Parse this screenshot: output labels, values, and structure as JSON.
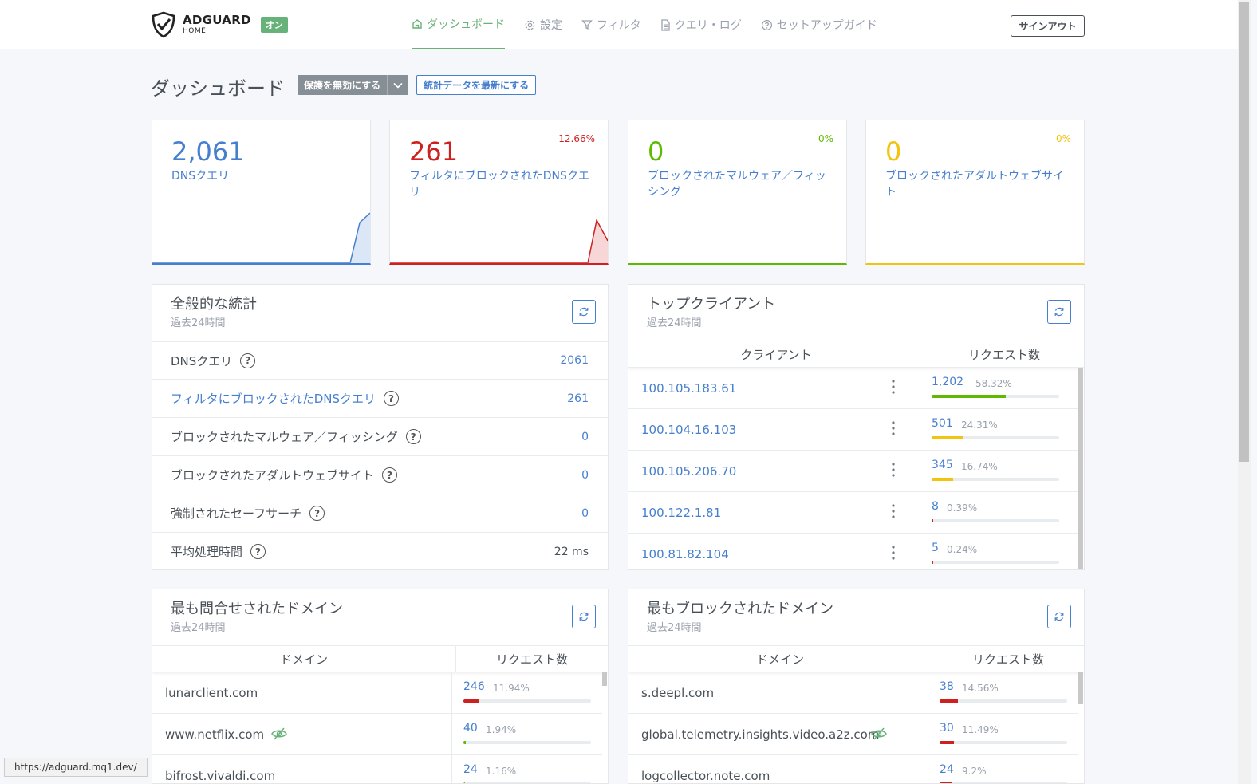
{
  "app": {
    "logo_name": "ADGUARD",
    "logo_sub": "HOME",
    "status_badge": "オン",
    "signout_label": "サインアウト"
  },
  "nav": {
    "items": [
      {
        "label": "ダッシュボード",
        "icon": "home-icon",
        "active": true
      },
      {
        "label": "設定",
        "icon": "gear-icon",
        "active": false
      },
      {
        "label": "フィルタ",
        "icon": "filter-icon",
        "active": false
      },
      {
        "label": "クエリ・ログ",
        "icon": "document-icon",
        "active": false
      },
      {
        "label": "セットアップガイド",
        "icon": "help-circle-icon",
        "active": false
      }
    ]
  },
  "header": {
    "title": "ダッシュボード",
    "disable_button": "保護を無効にする",
    "refresh_button": "統計データを最新にする"
  },
  "stats": [
    {
      "value": "2,061",
      "label": "DNSクエリ",
      "percent": "",
      "color": "#467fcf"
    },
    {
      "value": "261",
      "label": "フィルタにブロックされたDNSクエリ",
      "percent": "12.66%",
      "color": "#cd201f"
    },
    {
      "value": "0",
      "label": "ブロックされたマルウェア／フィッシング",
      "percent": "0%",
      "color": "#5eba00"
    },
    {
      "value": "0",
      "label": "ブロックされたアダルトウェブサイト",
      "percent": "0%",
      "color": "#f1c40f"
    }
  ],
  "general": {
    "title": "全般的な統計",
    "subtitle": "過去24時間",
    "rows": [
      {
        "label": "DNSクエリ",
        "value": "2061",
        "link": false
      },
      {
        "label": "フィルタにブロックされたDNSクエリ",
        "value": "261",
        "link": true
      },
      {
        "label": "ブロックされたマルウェア／フィッシング",
        "value": "0",
        "link": false
      },
      {
        "label": "ブロックされたアダルトウェブサイト",
        "value": "0",
        "link": false
      },
      {
        "label": "強制されたセーフサーチ",
        "value": "0",
        "link": false
      },
      {
        "label": "平均処理時間",
        "value": "22 ms",
        "link": false
      }
    ]
  },
  "top_clients": {
    "title": "トップクライアント",
    "subtitle": "過去24時間",
    "col_client": "クライアント",
    "col_requests": "リクエスト数",
    "rows": [
      {
        "name": "100.105.183.61",
        "count": "1,202",
        "percent": "58.32%",
        "fraction": 0.5832,
        "color": "#5eba00"
      },
      {
        "name": "100.104.16.103",
        "count": "501",
        "percent": "24.31%",
        "fraction": 0.2431,
        "color": "#f1c40f"
      },
      {
        "name": "100.105.206.70",
        "count": "345",
        "percent": "16.74%",
        "fraction": 0.1674,
        "color": "#f1c40f"
      },
      {
        "name": "100.122.1.81",
        "count": "8",
        "percent": "0.39%",
        "fraction": 0.0039,
        "color": "#cd201f"
      },
      {
        "name": "100.81.82.104",
        "count": "5",
        "percent": "0.24%",
        "fraction": 0.0024,
        "color": "#cd201f"
      }
    ]
  },
  "top_queried": {
    "title": "最も問合せされたドメイン",
    "subtitle": "過去24時間",
    "col_domain": "ドメイン",
    "col_requests": "リクエスト数",
    "rows": [
      {
        "name": "lunarclient.com",
        "count": "246",
        "percent": "11.94%",
        "fraction": 0.1194,
        "color": "#cd201f",
        "tracker": false
      },
      {
        "name": "www.netflix.com",
        "count": "40",
        "percent": "1.94%",
        "fraction": 0.0194,
        "color": "#5eba00",
        "tracker": true
      },
      {
        "name": "bifrost.vivaldi.com",
        "count": "24",
        "percent": "1.16%",
        "fraction": 0.0116,
        "color": "#5eba00",
        "tracker": false
      }
    ]
  },
  "top_blocked": {
    "title": "最もブロックされたドメイン",
    "subtitle": "過去24時間",
    "col_domain": "ドメイン",
    "col_requests": "リクエスト数",
    "rows": [
      {
        "name": "s.deepl.com",
        "count": "38",
        "percent": "14.56%",
        "fraction": 0.1456,
        "color": "#cd201f",
        "tracker": false
      },
      {
        "name": "global.telemetry.insights.video.a2z.com",
        "count": "30",
        "percent": "11.49%",
        "fraction": 0.1149,
        "color": "#cd201f",
        "tracker": true
      },
      {
        "name": "logcollector.note.com",
        "count": "24",
        "percent": "9.2%",
        "fraction": 0.092,
        "color": "#cd201f",
        "tracker": false
      }
    ]
  },
  "status_bar": {
    "url": "https://adguard.mq1.dev/"
  }
}
